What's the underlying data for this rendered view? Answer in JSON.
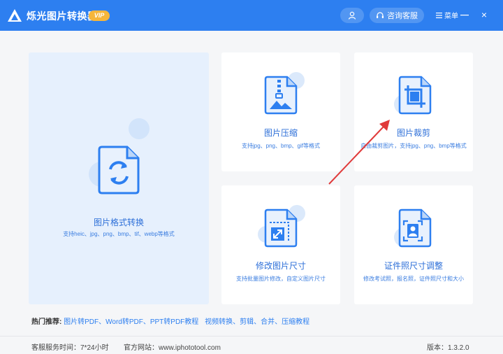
{
  "titlebar": {
    "app_title": "烁光图片转换器",
    "vip_badge": "VIP",
    "customer_service": "咨询客服",
    "menu": "菜单",
    "close": "×"
  },
  "tools": {
    "format_convert": {
      "title": "图片格式转换",
      "desc": "支持heic、jpg、png、bmp、tif、webp等格式",
      "icon": "convert-file-icon"
    },
    "compress": {
      "title": "图片压缩",
      "desc": "支持jpg、png、bmp、gif等格式",
      "icon": "zip-image-icon"
    },
    "crop": {
      "title": "图片裁剪",
      "desc": "自由裁剪图片，支持jpg、png、bmp等格式",
      "icon": "crop-icon"
    },
    "resize": {
      "title": "修改图片尺寸",
      "desc": "支持批量图片修改，自定义图片尺寸",
      "icon": "resize-icon"
    },
    "id_photo": {
      "title": "证件照尺寸调整",
      "desc": "修改考试照，报名照，证件照尺寸和大小",
      "icon": "id-photo-icon"
    }
  },
  "hot": {
    "label": "热门推荐:",
    "link1": "图片转PDF、Word转PDF、PPT转PDF教程",
    "link2": "视频转换、剪辑、合并、压缩教程"
  },
  "footer": {
    "service_time": "客服服务时间：7*24小时",
    "website": "官方网站：www.iphototool.com",
    "version": "版本：1.3.2.0"
  },
  "colors": {
    "primary": "#2d7ff0",
    "accent_red": "#e03a3a",
    "vip": "#f6b63a"
  }
}
